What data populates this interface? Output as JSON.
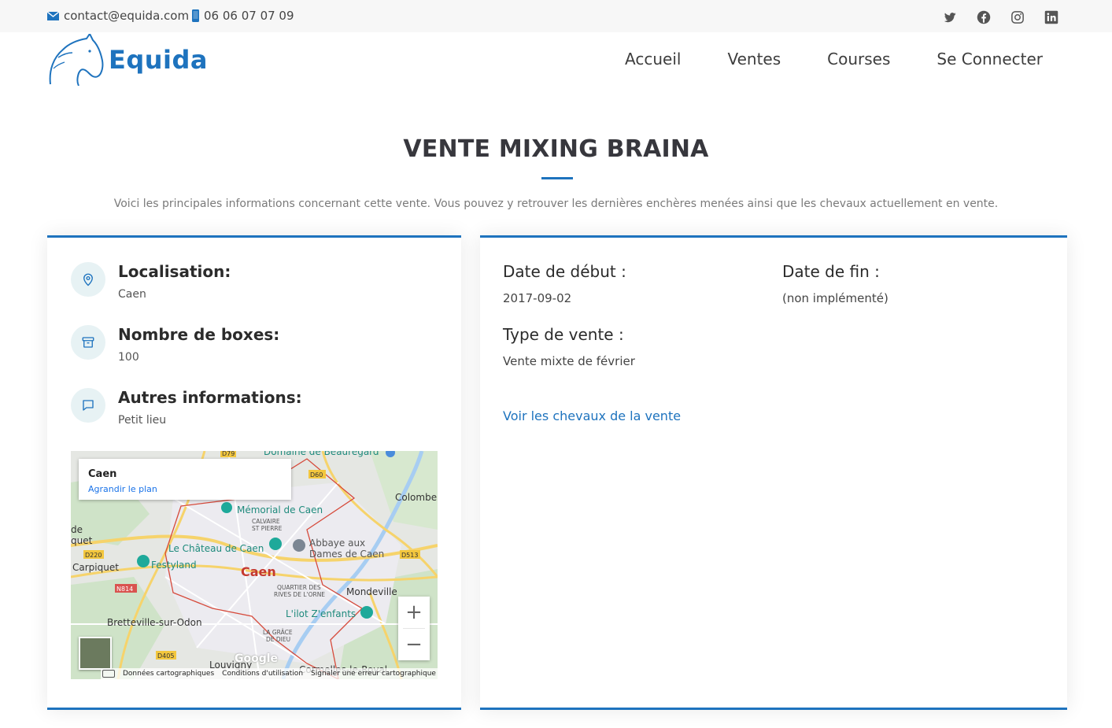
{
  "topbar": {
    "email": "contact@equida.com",
    "phone": "06 06 07 07 09",
    "social_icons": [
      "twitter-icon",
      "facebook-icon",
      "instagram-icon",
      "linkedin-icon"
    ]
  },
  "header": {
    "logo_text": "Equida",
    "nav": [
      "Accueil",
      "Ventes",
      "Courses",
      "Se Connecter"
    ]
  },
  "section": {
    "title": "VENTE MIXING BRAINA",
    "subtitle": "Voici les principales informations concernant cette vente. Vous pouvez y retrouver les dernières enchères menées ainsi que les chevaux actuellement en vente."
  },
  "info": [
    {
      "label": "Localisation:",
      "value": "Caen",
      "icon": "map-pin-icon"
    },
    {
      "label": "Nombre de boxes:",
      "value": "100",
      "icon": "archive-box-icon"
    },
    {
      "label": "Autres informations:",
      "value": "Petit lieu",
      "icon": "chat-bubble-icon"
    }
  ],
  "map": {
    "place": "Caen",
    "enlarge_link": "Agrandir le plan",
    "city_label": "Caen",
    "labels": [
      "Mémorial de Caen",
      "Le Château de Caen",
      "Abbaye aux Dames de Caen",
      "Festyland",
      "Carpiquet",
      "Mondeville",
      "L'ilot Z'enfants",
      "Bretteville-sur-Odon",
      "Colombelles",
      "Louvigny",
      "Domaine de Beauregard",
      "CALVAIRE ST PIERRE",
      "QUARTIER DES RIVES DE L'ORNE",
      "LA GRÂCE DE DIEU",
      "Cormelles-le-Royal"
    ],
    "road_labels": [
      "D79",
      "D60",
      "D220",
      "N814",
      "D513",
      "D405"
    ],
    "google_mark": "Google",
    "footer": [
      "Données cartographiques",
      "Conditions d'utilisation",
      "Signaler une erreur cartographique"
    ]
  },
  "details": {
    "start_label": "Date de début :",
    "start_value": "2017-09-02",
    "end_label": "Date de fin :",
    "end_value": "(non implémenté)",
    "type_label": "Type de vente :",
    "type_value": "Vente mixte de février",
    "link": "Voir les chevaux de la vente"
  },
  "colors": {
    "accent": "#1e73be",
    "icon_bg": "#e7f2f4"
  }
}
